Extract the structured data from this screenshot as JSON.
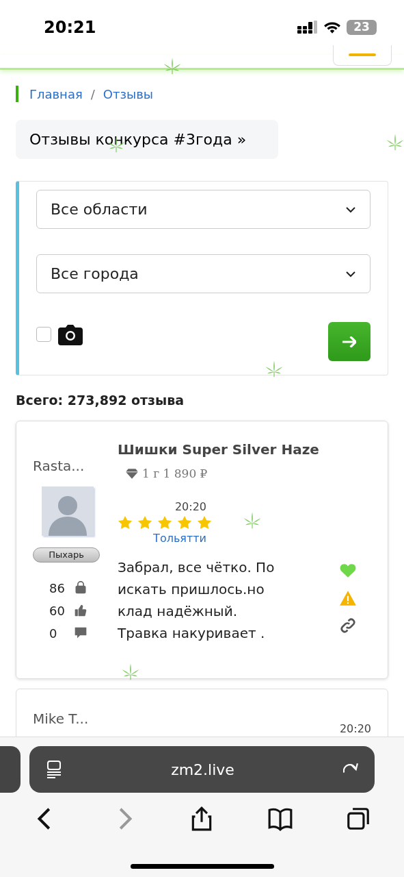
{
  "status_bar": {
    "time": "20:21",
    "battery": "23"
  },
  "breadcrumb": [
    {
      "label": "Главная"
    },
    {
      "label": "Отзывы"
    }
  ],
  "breadcrumb_separator": "/",
  "contest_link": "Отзывы конкурса #3года »",
  "filters": {
    "selects": [
      {
        "value": "Все области"
      },
      {
        "value": "Все города"
      }
    ],
    "photo_only": {
      "checked": false
    }
  },
  "total": "Всего: 273,892 отзыва",
  "reviews": [
    {
      "author": "Rasta...",
      "rank": "Пыхарь",
      "purchases": "86",
      "likes": "60",
      "comments": "0",
      "product": "Шишки Super Silver Haze",
      "variant": "1 г 1 890 ₽",
      "time": "20:20",
      "stars": 5,
      "city": "Тольятти",
      "text": "Забрал, все чётко. По искать пришлось.но клад надёжный. Травка накуривает ."
    },
    {
      "author": "Mike T...",
      "time": "20:20"
    }
  ],
  "browser": {
    "url": "zm2.live"
  }
}
